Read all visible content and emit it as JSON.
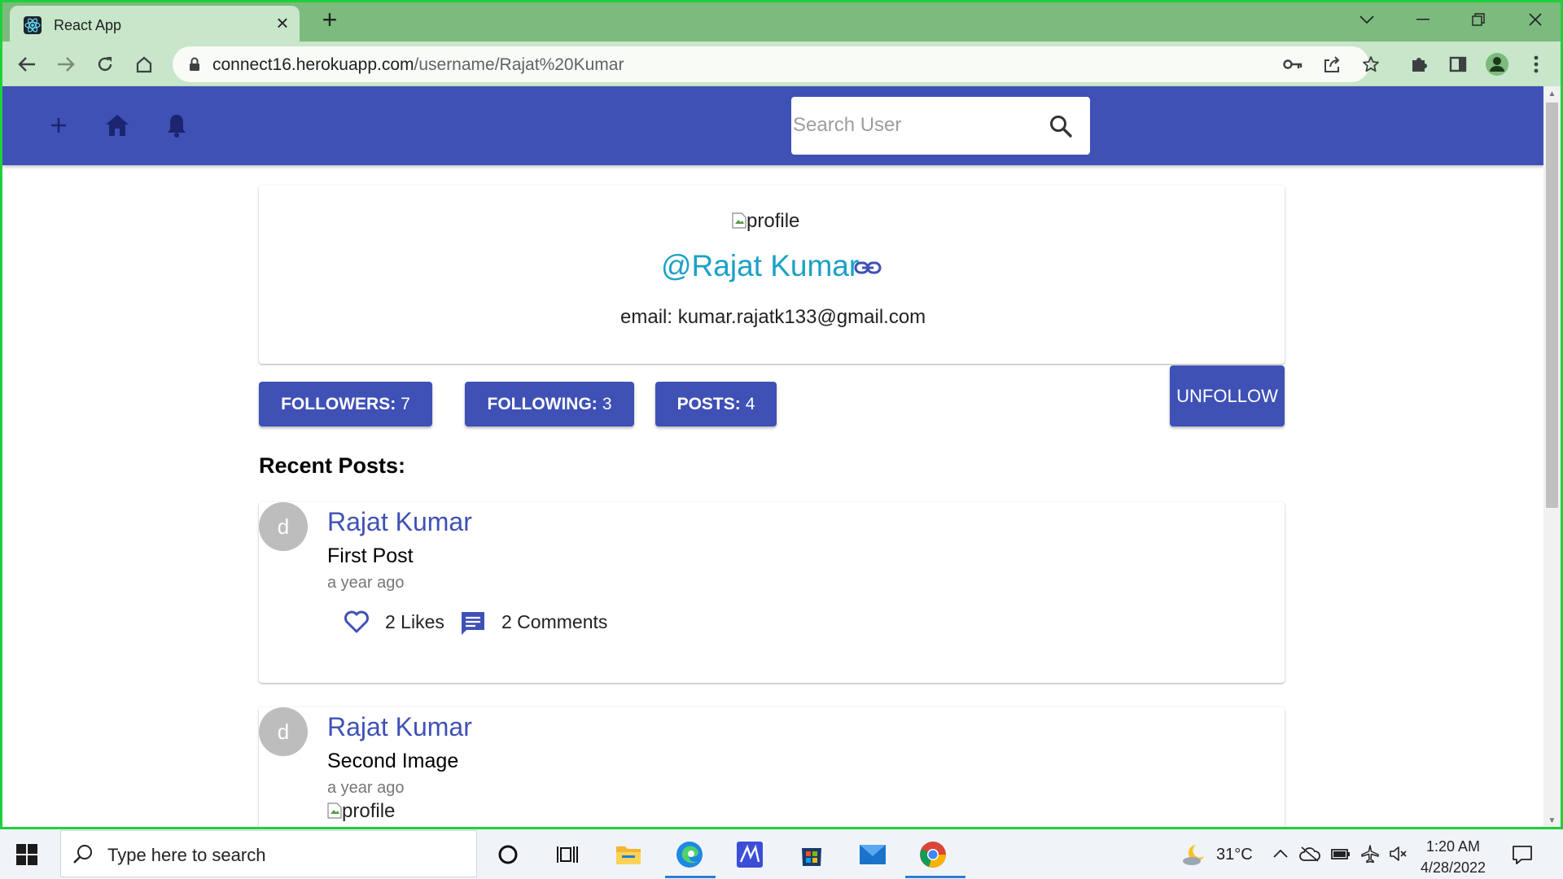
{
  "browser": {
    "tab_title": "React App",
    "url_host": "connect16.herokuapp.com",
    "url_path": "/username/Rajat%20Kumar"
  },
  "appbar": {
    "search_placeholder": "Search User"
  },
  "profile": {
    "image_alt": "profile",
    "username": "@Rajat Kumar",
    "email": "email: kumar.rajatk133@gmail.com"
  },
  "stats": {
    "followers_label": "FOLLOWERS:",
    "followers_count": "7",
    "following_label": "FOLLOWING:",
    "following_count": "3",
    "posts_label": "POSTS:",
    "posts_count": "4",
    "unfollow_label": "UNFOLLOW"
  },
  "recent_posts": {
    "heading": "Recent Posts:",
    "posts": [
      {
        "avatar_letter": "d",
        "author": "Rajat Kumar",
        "title": "First Post",
        "time": "a year ago",
        "likes": "2 Likes",
        "comments": "2 Comments"
      },
      {
        "avatar_letter": "d",
        "author": "Rajat Kumar",
        "title": "Second Image",
        "time": "a year ago",
        "image_alt": "profile"
      }
    ]
  },
  "taskbar": {
    "search_placeholder": "Type here to search",
    "weather": "31°C",
    "time": "1:20 AM",
    "date": "4/28/2022"
  },
  "colors": {
    "primary": "#3f51b5",
    "username_accent": "#1ba1c6",
    "browser_frame": "#7cba7e",
    "window_border": "#1ed13a"
  }
}
